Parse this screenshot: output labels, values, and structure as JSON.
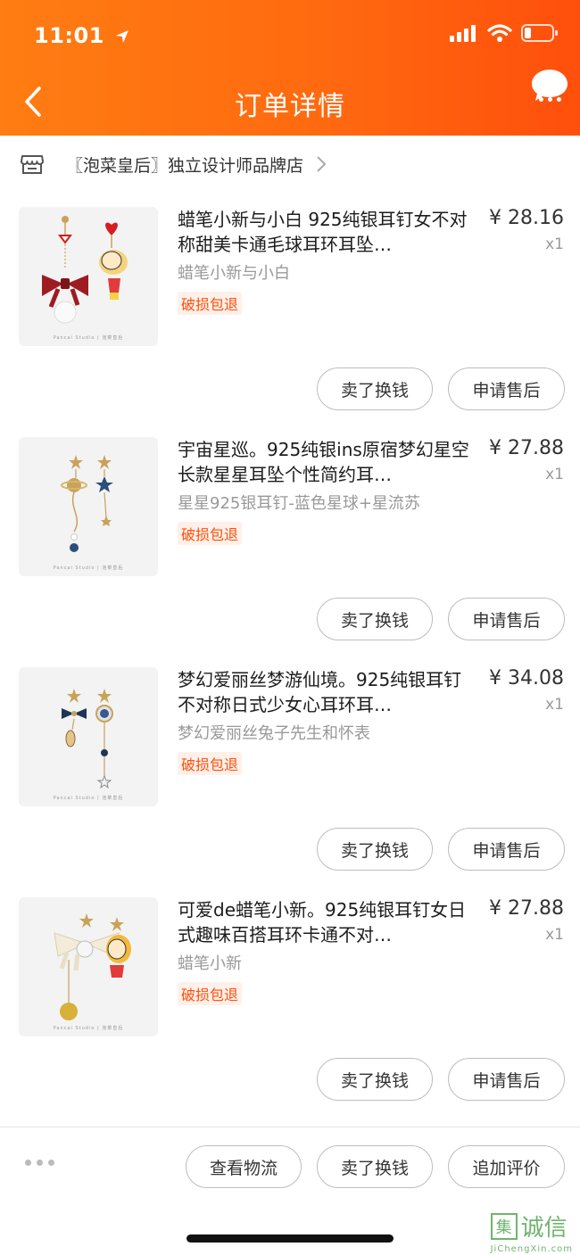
{
  "status_bar": {
    "time": "11:01"
  },
  "nav": {
    "title": "订单详情"
  },
  "shop": {
    "name": "〖泡菜皇后〗独立设计师品牌店"
  },
  "items": [
    {
      "title": "蜡笔小新与小白 925纯银耳钉女不对称甜美卡通毛球耳环耳坠…",
      "sku": "蜡笔小新与小白",
      "badge": "破损包退",
      "price": "¥ 28.16",
      "qty": "x1",
      "thumb_caption": "Pancai Studio | 泡菜皇后"
    },
    {
      "title": "宇宙星巡。925纯银ins原宿梦幻星空长款星星耳坠个性简约耳…",
      "sku": "星星925银耳钉-蓝色星球+星流苏",
      "badge": "破损包退",
      "price": "¥ 27.88",
      "qty": "x1",
      "thumb_caption": "Pancai Studio | 泡菜皇后"
    },
    {
      "title": "梦幻爱丽丝梦游仙境。925纯银耳钉不对称日式少女心耳环耳…",
      "sku": "梦幻爱丽丝兔子先生和怀表",
      "badge": "破损包退",
      "price": "¥ 34.08",
      "qty": "x1",
      "thumb_caption": "Pancai Studio | 泡菜皇后"
    },
    {
      "title": "可爱de蜡笔小新。925纯银耳钉女日式趣味百搭耳环卡通不对…",
      "sku": "蜡笔小新",
      "badge": "破损包退",
      "price": "¥ 27.88",
      "qty": "x1",
      "thumb_caption": "Pancai Studio | 泡菜皇后"
    }
  ],
  "item_buttons": {
    "sell": "卖了换钱",
    "after_sale": "申请售后"
  },
  "bottom": {
    "logistics": "查看物流",
    "sell": "卖了换钱",
    "review": "追加评价"
  },
  "watermark": {
    "logo_box": "集",
    "logo_text": "诚信",
    "url": "JiChengXin.com"
  },
  "colors": {
    "header_start": "#ff7d12",
    "header_end": "#ff4f0c",
    "badge": "#ff4f0c"
  }
}
